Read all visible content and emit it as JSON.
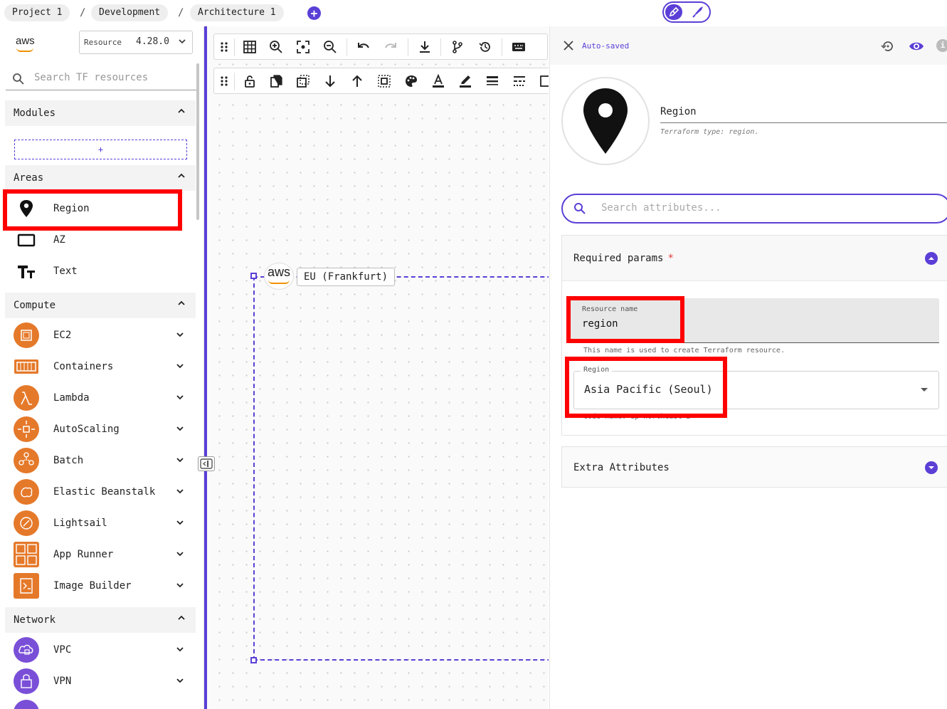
{
  "breadcrumbs": [
    "Project 1",
    "Development",
    "Architecture 1"
  ],
  "breadcrumb_sep": "/",
  "add_project_symbol": "+",
  "sidebar": {
    "logo_text": "aws",
    "version_label": "Resource",
    "version_value": "4.28.0",
    "search_placeholder": "Search TF resources",
    "modules": {
      "title": "Modules",
      "add_symbol": "+"
    },
    "areas": {
      "title": "Areas",
      "items": [
        {
          "label": "Region",
          "icon": "map-pin-icon"
        },
        {
          "label": "AZ",
          "icon": "rectangle-icon"
        },
        {
          "label": "Text",
          "icon": "text-size-icon"
        }
      ]
    },
    "compute": {
      "title": "Compute",
      "items": [
        {
          "label": "EC2",
          "icon": "ec2-icon"
        },
        {
          "label": "Containers",
          "icon": "containers-icon"
        },
        {
          "label": "Lambda",
          "icon": "lambda-icon"
        },
        {
          "label": "AutoScaling",
          "icon": "autoscaling-icon"
        },
        {
          "label": "Batch",
          "icon": "batch-icon"
        },
        {
          "label": "Elastic Beanstalk",
          "icon": "elastic-beanstalk-icon"
        },
        {
          "label": "Lightsail",
          "icon": "lightsail-icon"
        },
        {
          "label": "App Runner",
          "icon": "app-runner-icon"
        },
        {
          "label": "Image Builder",
          "icon": "image-builder-icon"
        }
      ]
    },
    "network": {
      "title": "Network",
      "items": [
        {
          "label": "VPC",
          "icon": "vpc-icon"
        },
        {
          "label": "VPN",
          "icon": "vpn-icon"
        }
      ]
    }
  },
  "canvas": {
    "region_logo_text": "aws",
    "region_node_label": "EU (Frankfurt)",
    "toolbar_row1_icons": [
      "drag-handle-icon",
      "grid-icon",
      "zoom-in-icon",
      "fit-screen-icon",
      "zoom-out-icon",
      "undo-icon",
      "redo-icon",
      "download-icon",
      "branch-icon",
      "history-icon",
      "keyboard-icon"
    ],
    "toolbar_row2_icons": [
      "drag-handle-icon",
      "lock-icon",
      "copy-icon",
      "select-icon",
      "arrow-down-icon",
      "arrow-up-icon",
      "group-icon",
      "palette-icon",
      "font-color-icon",
      "pen-icon",
      "line-weight-icon",
      "line-style-icon",
      "frame-icon"
    ]
  },
  "panel": {
    "status": "Auto-saved",
    "info_symbol": "i",
    "resource_title": "Region",
    "resource_type": "Terraform type: region.",
    "search_placeholder": "Search attributes...",
    "required": {
      "title": "Required params",
      "star": "*",
      "name_label": "Resource name",
      "name_value": "region",
      "name_helper": "This name is used to create Terraform resource.",
      "region_label": "Region",
      "region_value": "Asia Pacific (Seoul)",
      "region_helper": "Code name: ap-northeast-2"
    },
    "extra": {
      "title": "Extra Attributes"
    }
  },
  "colors": {
    "accent": "#5b3fd6",
    "aws_orange": "#e5792a",
    "highlight": "#ff0000"
  }
}
